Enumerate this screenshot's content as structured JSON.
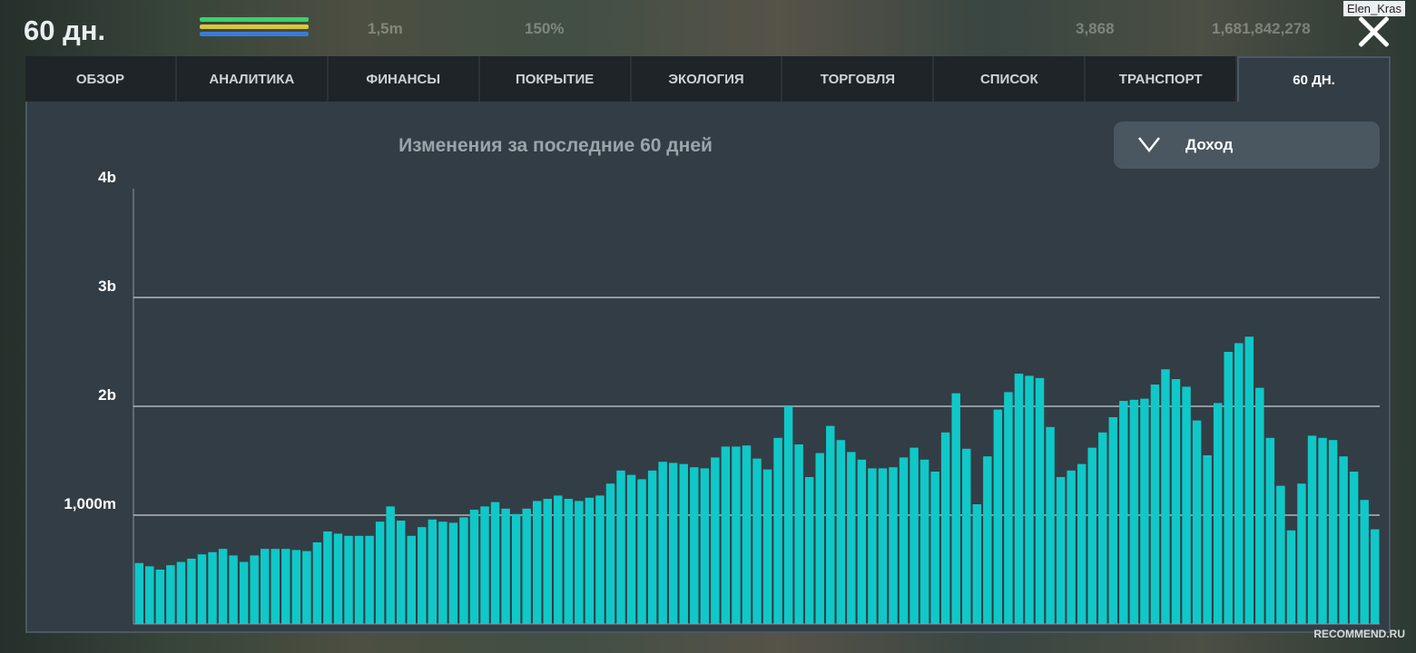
{
  "header": {
    "title": "60 дн.",
    "population": "1,5m",
    "happiness": "150%",
    "coins": "3,868",
    "money": "1,681,842,278",
    "username": "Elen_Kras",
    "bar_colors": [
      "#3bd16b",
      "#d8c83a",
      "#3b7bd8"
    ]
  },
  "tabs": [
    {
      "label": "ОБЗОР",
      "active": false
    },
    {
      "label": "АНАЛИТИКА",
      "active": false
    },
    {
      "label": "ФИНАНСЫ",
      "active": false
    },
    {
      "label": "ПОКРЫТИЕ",
      "active": false
    },
    {
      "label": "ЭКОЛОГИЯ",
      "active": false
    },
    {
      "label": "ТОРГОВЛЯ",
      "active": false
    },
    {
      "label": "СПИСОК",
      "active": false
    },
    {
      "label": "ТРАНСПОРТ",
      "active": false
    },
    {
      "label": "60 ДН.",
      "active": true
    }
  ],
  "dropdown": {
    "selected": "Доход",
    "icon": "chevron-down-icon"
  },
  "watermark": "RECOMMEND.RU",
  "chart_data": {
    "type": "bar",
    "title": "Изменения за последние 60 дней",
    "ylim": [
      0,
      4000000000
    ],
    "yticks": [
      {
        "value": 1000000000,
        "label": "1,000m"
      },
      {
        "value": 2000000000,
        "label": "2b"
      },
      {
        "value": 3000000000,
        "label": "3b"
      },
      {
        "value": 4000000000,
        "label": "4b"
      }
    ],
    "grid": true,
    "bar_color": "#10c8c8",
    "values": [
      0.56,
      0.53,
      0.5,
      0.54,
      0.57,
      0.6,
      0.64,
      0.66,
      0.69,
      0.63,
      0.57,
      0.63,
      0.69,
      0.69,
      0.69,
      0.68,
      0.67,
      0.75,
      0.85,
      0.83,
      0.81,
      0.81,
      0.81,
      0.94,
      1.08,
      0.95,
      0.81,
      0.89,
      0.96,
      0.94,
      0.93,
      0.98,
      1.05,
      1.08,
      1.12,
      1.06,
      1.01,
      1.06,
      1.13,
      1.15,
      1.18,
      1.15,
      1.13,
      1.16,
      1.18,
      1.29,
      1.41,
      1.37,
      1.33,
      1.41,
      1.49,
      1.48,
      1.47,
      1.44,
      1.43,
      1.53,
      1.63,
      1.63,
      1.64,
      1.52,
      1.42,
      1.71,
      2.0,
      1.65,
      1.35,
      1.57,
      1.82,
      1.69,
      1.58,
      1.51,
      1.43,
      1.43,
      1.44,
      1.53,
      1.62,
      1.51,
      1.4,
      1.76,
      2.12,
      1.61,
      1.1,
      1.54,
      1.97,
      2.13,
      2.3,
      2.28,
      2.26,
      1.81,
      1.35,
      1.41,
      1.47,
      1.62,
      1.76,
      1.9,
      2.05,
      2.06,
      2.07,
      2.2,
      2.34,
      2.25,
      2.18,
      1.87,
      1.55,
      2.03,
      2.5,
      2.58,
      2.64,
      2.17,
      1.71,
      1.27,
      0.86,
      1.29,
      1.73,
      1.71,
      1.69,
      1.54,
      1.4,
      1.14,
      0.87
    ]
  }
}
